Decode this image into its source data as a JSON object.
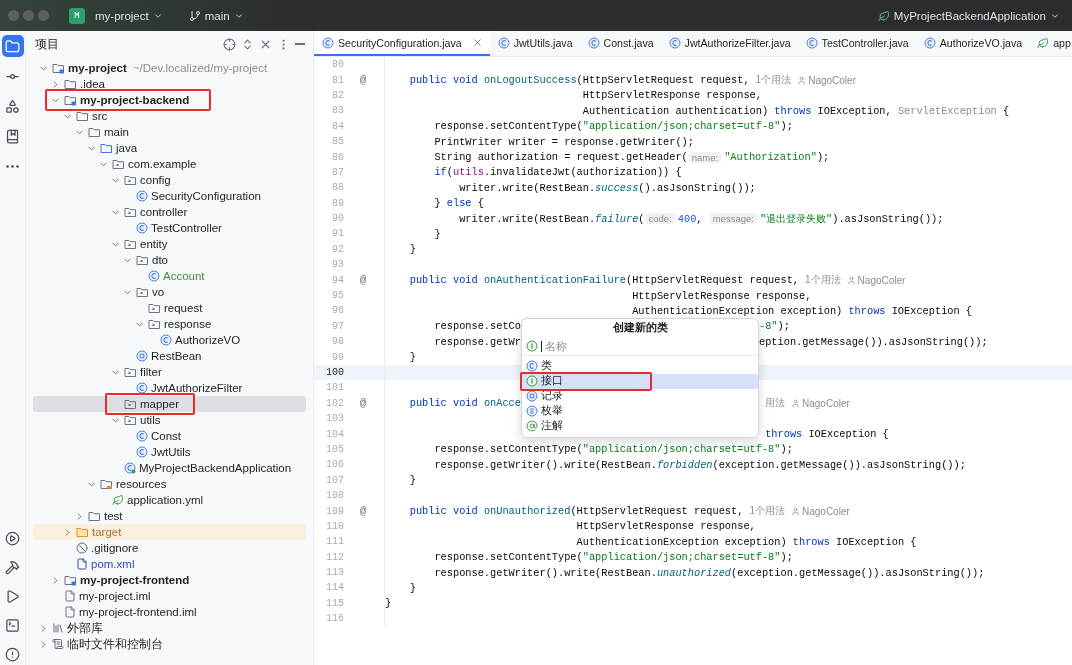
{
  "title_bar": {
    "project_badge": "M",
    "project": "my-project",
    "branch": "main",
    "run_config": "MyProjectBackendApplication"
  },
  "toolbar_top": [
    {
      "kind": "project",
      "selected": true
    },
    {
      "kind": "commit",
      "selected": false
    },
    {
      "kind": "structure",
      "selected": false
    },
    {
      "kind": "bookmarks",
      "selected": false
    },
    {
      "kind": "more",
      "selected": false
    }
  ],
  "toolbar_bottom": [
    {
      "kind": "services"
    },
    {
      "kind": "build"
    },
    {
      "kind": "run"
    },
    {
      "kind": "terminal"
    },
    {
      "kind": "problems"
    }
  ],
  "project_panel": {
    "title": "项目",
    "items": [
      {
        "label": "my-project",
        "kind": "module",
        "path": "~/Dev.localized/my-project",
        "expanded": true,
        "selected": false,
        "highlighted": false,
        "children": [
          {
            "label": ".idea",
            "kind": "folder",
            "expanded": false,
            "selected": false,
            "highlighted": false
          },
          {
            "label": "my-project-backend",
            "kind": "module",
            "expanded": true,
            "selected": false,
            "highlighted": true,
            "children": [
              {
                "label": "src",
                "kind": "folder",
                "expanded": true,
                "selected": false,
                "highlighted": false,
                "children": [
                  {
                    "label": "main",
                    "kind": "folder",
                    "expanded": true,
                    "selected": false,
                    "highlighted": false,
                    "children": [
                      {
                        "label": "java",
                        "kind": "source",
                        "expanded": true,
                        "selected": false,
                        "highlighted": false,
                        "children": [
                          {
                            "label": "com.example",
                            "kind": "package",
                            "expanded": true,
                            "selected": false,
                            "highlighted": false,
                            "children": [
                              {
                                "label": "config",
                                "kind": "package",
                                "expanded": true,
                                "selected": false,
                                "highlighted": false,
                                "children": [
                                  {
                                    "label": "SecurityConfiguration",
                                    "kind": "class",
                                    "selected": false,
                                    "highlighted": false
                                  }
                                ]
                              },
                              {
                                "label": "controller",
                                "kind": "package",
                                "expanded": true,
                                "selected": false,
                                "highlighted": false,
                                "children": [
                                  {
                                    "label": "TestController",
                                    "kind": "class",
                                    "selected": false,
                                    "highlighted": false
                                  }
                                ]
                              },
                              {
                                "label": "entity",
                                "kind": "package",
                                "expanded": true,
                                "selected": false,
                                "highlighted": false,
                                "children": [
                                  {
                                    "label": "dto",
                                    "kind": "package",
                                    "expanded": true,
                                    "selected": false,
                                    "highlighted": false,
                                    "children": [
                                      {
                                        "label": "Account",
                                        "kind": "class",
                                        "color": "#3f8f3f",
                                        "selected": false,
                                        "highlighted": false
                                      }
                                    ]
                                  },
                                  {
                                    "label": "vo",
                                    "kind": "package",
                                    "expanded": true,
                                    "selected": false,
                                    "highlighted": false,
                                    "children": [
                                      {
                                        "label": "request",
                                        "kind": "package",
                                        "selected": false,
                                        "highlighted": false
                                      },
                                      {
                                        "label": "response",
                                        "kind": "package",
                                        "expanded": true,
                                        "selected": false,
                                        "highlighted": false,
                                        "children": [
                                          {
                                            "label": "AuthorizeVO",
                                            "kind": "class",
                                            "selected": false,
                                            "highlighted": false
                                          }
                                        ]
                                      }
                                    ]
                                  },
                                  {
                                    "label": "RestBean",
                                    "kind": "record",
                                    "selected": false,
                                    "highlighted": false
                                  }
                                ]
                              },
                              {
                                "label": "filter",
                                "kind": "package",
                                "expanded": true,
                                "selected": false,
                                "highlighted": false,
                                "children": [
                                  {
                                    "label": "JwtAuthorizeFilter",
                                    "kind": "class",
                                    "selected": false,
                                    "highlighted": false
                                  }
                                ]
                              },
                              {
                                "label": "mapper",
                                "kind": "package",
                                "selected": true,
                                "highlighted": true
                              },
                              {
                                "label": "utils",
                                "kind": "package",
                                "expanded": true,
                                "selected": false,
                                "highlighted": false,
                                "children": [
                                  {
                                    "label": "Const",
                                    "kind": "class",
                                    "selected": false,
                                    "highlighted": false
                                  },
                                  {
                                    "label": "JwtUtils",
                                    "kind": "class",
                                    "selected": false,
                                    "highlighted": false
                                  }
                                ]
                              },
                              {
                                "label": "MyProjectBackendApplication",
                                "kind": "app",
                                "selected": false,
                                "highlighted": false
                              }
                            ]
                          }
                        ]
                      },
                      {
                        "label": "resources",
                        "kind": "resources",
                        "expanded": true,
                        "selected": false,
                        "highlighted": false,
                        "children": [
                          {
                            "label": "application.yml",
                            "kind": "yaml",
                            "selected": false,
                            "highlighted": false
                          }
                        ]
                      }
                    ]
                  },
                  {
                    "label": "test",
                    "kind": "folder",
                    "expanded": false,
                    "selected": false,
                    "highlighted": false
                  }
                ]
              },
              {
                "label": "target",
                "kind": "excluded",
                "color": "#b0702f",
                "expanded": false,
                "selected": false,
                "highlighted": false
              },
              {
                "label": ".gitignore",
                "kind": "ignore",
                "selected": false,
                "highlighted": false
              },
              {
                "label": "pom.xml",
                "kind": "maven",
                "color": "#2850b8",
                "selected": false,
                "highlighted": false
              }
            ]
          },
          {
            "label": "my-project-frontend",
            "kind": "module",
            "expanded": false,
            "selected": false,
            "highlighted": false
          },
          {
            "label": "my-project.iml",
            "kind": "iml",
            "selected": false,
            "highlighted": false
          },
          {
            "label": "my-project-frontend.iml",
            "kind": "iml",
            "selected": false,
            "highlighted": false
          }
        ]
      },
      {
        "label": "外部库",
        "kind": "library",
        "expanded": false,
        "selected": false,
        "highlighted": false
      },
      {
        "label": "临时文件和控制台",
        "kind": "scratch",
        "expanded": false,
        "selected": false,
        "highlighted": false
      }
    ]
  },
  "tabs": [
    {
      "label": "SecurityConfiguration.java",
      "kind": "class",
      "selected": true
    },
    {
      "label": "JwtUtils.java",
      "kind": "class",
      "selected": false
    },
    {
      "label": "Const.java",
      "kind": "class",
      "selected": false
    },
    {
      "label": "JwtAuthorizeFilter.java",
      "kind": "class",
      "selected": false
    },
    {
      "label": "TestController.java",
      "kind": "class",
      "selected": false
    },
    {
      "label": "AuthorizeVO.java",
      "kind": "class",
      "selected": false
    },
    {
      "label": "app",
      "kind": "yaml",
      "selected": false
    }
  ],
  "editor": {
    "lines": [
      {
        "number": "80",
        "current": false
      },
      {
        "number": "81",
        "current": false,
        "gutter": "@",
        "segs": [
          {
            "kind": "kw",
            "text": "    public void "
          },
          {
            "kind": "fn",
            "text": "onLogoutSuccess"
          },
          {
            "kind": "p",
            "text": "(HttpServletRequest request,"
          },
          {
            "kind": "meta",
            "text": "1个用法"
          },
          {
            "kind": "author",
            "text": "NagoColer"
          }
        ]
      },
      {
        "number": "82",
        "current": false,
        "segs": [
          {
            "kind": "p",
            "text": "                                HttpServletResponse response,"
          }
        ]
      },
      {
        "number": "83",
        "current": false,
        "segs": [
          {
            "kind": "p",
            "text": "                                Authentication authentication) "
          },
          {
            "kind": "kw",
            "text": "throws"
          },
          {
            "kind": "p",
            "text": " IOException, "
          },
          {
            "kind": "gray",
            "text": "ServletException"
          },
          {
            "kind": "p",
            "text": " {"
          }
        ]
      },
      {
        "number": "84",
        "current": false,
        "segs": [
          {
            "kind": "p",
            "text": "        response.setContentType("
          },
          {
            "kind": "str",
            "text": "\"application/json;charset=utf-8\""
          },
          {
            "kind": "p",
            "text": ");"
          }
        ]
      },
      {
        "number": "85",
        "current": false,
        "segs": [
          {
            "kind": "p",
            "text": "        PrintWriter writer = response.getWriter();"
          }
        ]
      },
      {
        "number": "86",
        "current": false,
        "segs": [
          {
            "kind": "p",
            "text": "        String authorization = request.getHeader("
          },
          {
            "kind": "hint",
            "text": "name:"
          },
          {
            "kind": "str",
            "text": "\"Authorization\""
          },
          {
            "kind": "p",
            "text": ");"
          }
        ]
      },
      {
        "number": "87",
        "current": false,
        "segs": [
          {
            "kind": "kw",
            "text": "        if"
          },
          {
            "kind": "p",
            "text": "("
          },
          {
            "kind": "field",
            "text": "utils"
          },
          {
            "kind": "p",
            "text": ".invalidateJwt(authorization)) {"
          }
        ]
      },
      {
        "number": "88",
        "current": false,
        "segs": [
          {
            "kind": "p",
            "text": "            writer.write(RestBean."
          },
          {
            "kind": "static",
            "text": "success"
          },
          {
            "kind": "p",
            "text": "().asJsonString());"
          }
        ]
      },
      {
        "number": "89",
        "current": false,
        "segs": [
          {
            "kind": "p",
            "text": "        } "
          },
          {
            "kind": "kw",
            "text": "else"
          },
          {
            "kind": "p",
            "text": " {"
          }
        ]
      },
      {
        "number": "90",
        "current": false,
        "segs": [
          {
            "kind": "p",
            "text": "            writer.write(RestBean."
          },
          {
            "kind": "static",
            "text": "failure"
          },
          {
            "kind": "p",
            "text": "("
          },
          {
            "kind": "hint",
            "text": "code:"
          },
          {
            "kind": "num",
            "text": "400"
          },
          {
            "kind": "p",
            "text": ", "
          },
          {
            "kind": "hint",
            "text": "message:"
          },
          {
            "kind": "str",
            "text": "\"退出登录失败\""
          },
          {
            "kind": "p",
            "text": ").asJsonString());"
          }
        ]
      },
      {
        "number": "91",
        "current": false,
        "segs": [
          {
            "kind": "p",
            "text": "        }"
          }
        ]
      },
      {
        "number": "92",
        "current": false,
        "segs": [
          {
            "kind": "p",
            "text": "    }"
          }
        ]
      },
      {
        "number": "93",
        "current": false
      },
      {
        "number": "94",
        "current": false,
        "gutter": "@",
        "segs": [
          {
            "kind": "kw",
            "text": "    public void "
          },
          {
            "kind": "fn",
            "text": "onAuthenticationFailure"
          },
          {
            "kind": "p",
            "text": "(HttpServletRequest request,"
          },
          {
            "kind": "meta",
            "text": "1个用法"
          },
          {
            "kind": "author",
            "text": "NagoColer"
          }
        ]
      },
      {
        "number": "95",
        "current": false,
        "segs": [
          {
            "kind": "p",
            "text": "                                        HttpServletResponse response,"
          }
        ]
      },
      {
        "number": "96",
        "current": false,
        "segs": [
          {
            "kind": "p",
            "text": "                                        AuthenticationException exception) "
          },
          {
            "kind": "kw",
            "text": "throws"
          },
          {
            "kind": "p",
            "text": " IOException {"
          }
        ]
      },
      {
        "number": "97",
        "current": false,
        "segs": [
          {
            "kind": "p",
            "text": "        response.setCo"
          }
        ],
        "after": [
          {
            "kind": "str",
            "text": "-8\""
          },
          {
            "kind": "p",
            "text": ");"
          }
        ]
      },
      {
        "number": "98",
        "current": false,
        "segs": [
          {
            "kind": "p",
            "text": "        response.getWr"
          }
        ],
        "after": [
          {
            "kind": "p",
            "text": "eption.getMessage()).asJsonString());"
          }
        ]
      },
      {
        "number": "99",
        "current": false,
        "segs": [
          {
            "kind": "p",
            "text": "    }"
          }
        ]
      },
      {
        "number": "100",
        "current": true
      },
      {
        "number": "101",
        "current": false
      },
      {
        "number": "102",
        "current": false,
        "gutter": "@",
        "segs": [
          {
            "kind": "kw",
            "text": "    public void "
          },
          {
            "kind": "fn",
            "text": "onAcce"
          }
        ],
        "after": [
          {
            "kind": "meta",
            "text": "用法"
          },
          {
            "kind": "author",
            "text": "NagoColer"
          }
        ]
      },
      {
        "number": "103",
        "current": false
      },
      {
        "number": "104",
        "current": false,
        "after": [
          {
            "kind": "kw",
            "text": " throws"
          },
          {
            "kind": "p",
            "text": " IOException {"
          }
        ]
      },
      {
        "number": "105",
        "current": false,
        "segs": [
          {
            "kind": "p",
            "text": "        response.setContentType("
          },
          {
            "kind": "str",
            "text": "\"application/json;charset=utf-8\""
          },
          {
            "kind": "p",
            "text": ");"
          }
        ]
      },
      {
        "number": "106",
        "current": false,
        "segs": [
          {
            "kind": "p",
            "text": "        response.getWriter().write(RestBean."
          },
          {
            "kind": "static",
            "text": "forbidden"
          },
          {
            "kind": "p",
            "text": "(exception.getMessage()).asJsonString());"
          }
        ]
      },
      {
        "number": "107",
        "current": false,
        "segs": [
          {
            "kind": "p",
            "text": "    }"
          }
        ]
      },
      {
        "number": "108",
        "current": false
      },
      {
        "number": "109",
        "current": false,
        "gutter": "@",
        "segs": [
          {
            "kind": "kw",
            "text": "    public void "
          },
          {
            "kind": "fn",
            "text": "onUnauthorized"
          },
          {
            "kind": "p",
            "text": "(HttpServletRequest request,"
          },
          {
            "kind": "meta",
            "text": "1个用法"
          },
          {
            "kind": "author",
            "text": "NagoColer"
          }
        ]
      },
      {
        "number": "110",
        "current": false,
        "segs": [
          {
            "kind": "p",
            "text": "                               HttpServletResponse response,"
          }
        ]
      },
      {
        "number": "111",
        "current": false,
        "segs": [
          {
            "kind": "p",
            "text": "                               AuthenticationException exception) "
          },
          {
            "kind": "kw",
            "text": "throws"
          },
          {
            "kind": "p",
            "text": " IOException {"
          }
        ]
      },
      {
        "number": "112",
        "current": false,
        "segs": [
          {
            "kind": "p",
            "text": "        response.setContentType("
          },
          {
            "kind": "str",
            "text": "\"application/json;charset=utf-8\""
          },
          {
            "kind": "p",
            "text": ");"
          }
        ]
      },
      {
        "number": "113",
        "current": false,
        "segs": [
          {
            "kind": "p",
            "text": "        response.getWriter().write(RestBean."
          },
          {
            "kind": "static",
            "text": "unauthorized"
          },
          {
            "kind": "p",
            "text": "(exception.getMessage()).asJsonString());"
          }
        ]
      },
      {
        "number": "114",
        "current": false,
        "segs": [
          {
            "kind": "p",
            "text": "    }"
          }
        ]
      },
      {
        "number": "115",
        "current": false,
        "segs": [
          {
            "kind": "p",
            "text": "}"
          }
        ]
      },
      {
        "number": "116",
        "current": false
      }
    ]
  },
  "popup": {
    "title": "创建新的类",
    "placeholder": "名称",
    "items": [
      {
        "label": "类",
        "kind": "class",
        "selected": false,
        "highlighted": false
      },
      {
        "label": "接口",
        "kind": "interface",
        "selected": true,
        "highlighted": true
      },
      {
        "label": "记录",
        "kind": "record",
        "selected": false,
        "highlighted": false
      },
      {
        "label": "枚举",
        "kind": "enum",
        "selected": false,
        "highlighted": false
      },
      {
        "label": "注解",
        "kind": "annotation",
        "selected": false,
        "highlighted": false
      }
    ]
  }
}
